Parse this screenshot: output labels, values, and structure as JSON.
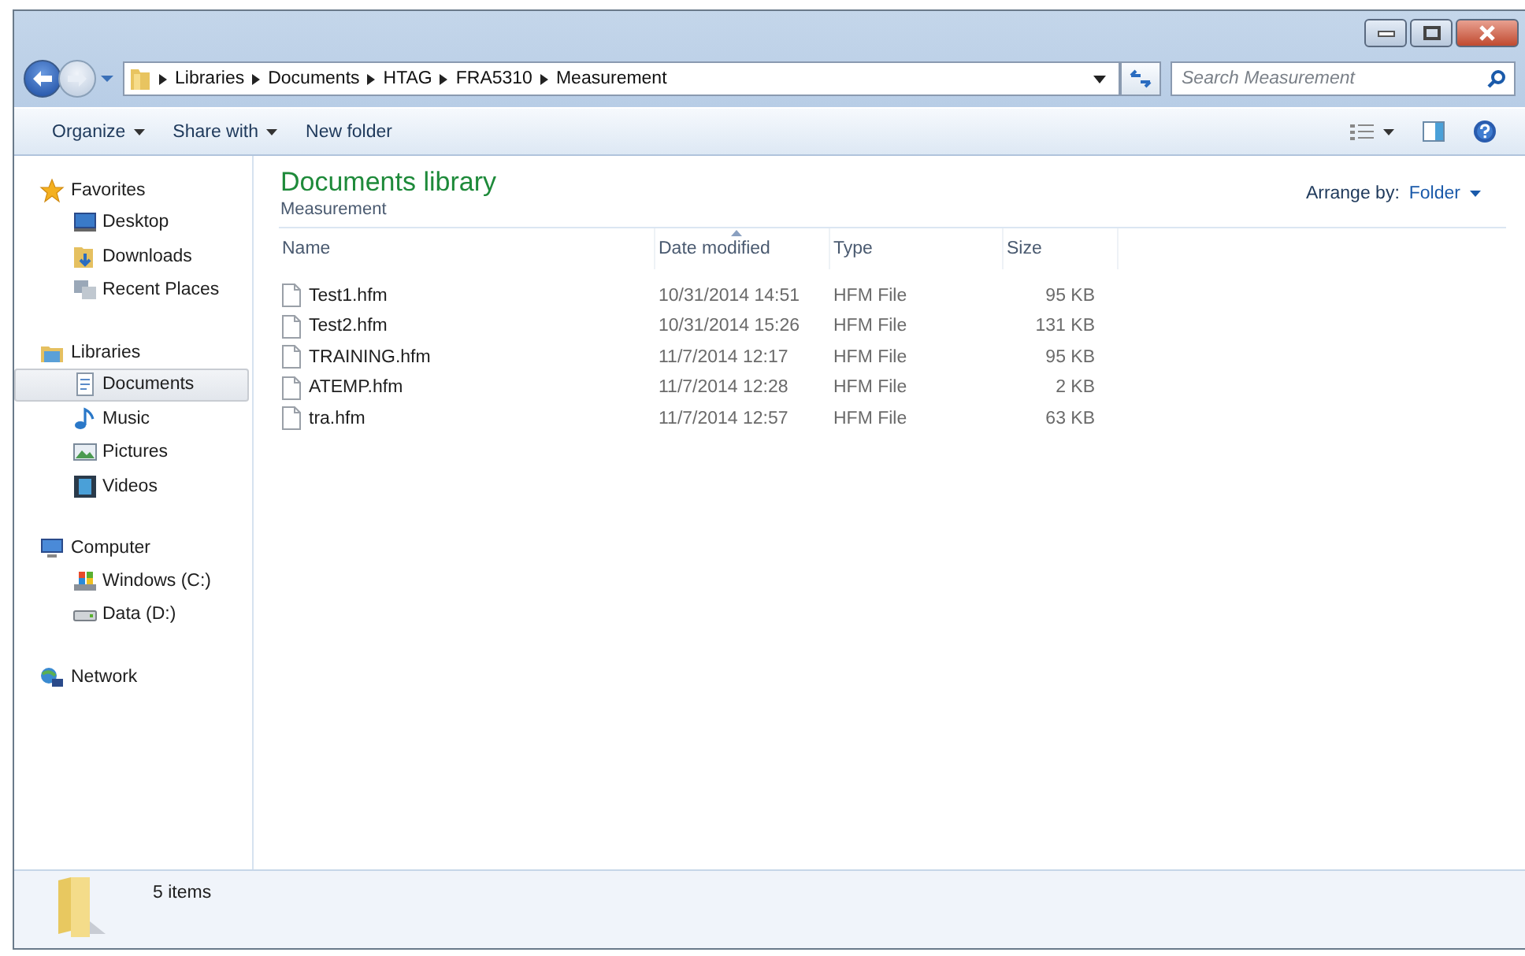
{
  "address": {
    "crumbs": [
      "Libraries",
      "Documents",
      "HTAG",
      "FRA5310",
      "Measurement"
    ]
  },
  "search": {
    "placeholder": "Search Measurement"
  },
  "toolbar": {
    "buttons": [
      {
        "label": "Organize",
        "dropdown": true
      },
      {
        "label": "Share with",
        "dropdown": true
      },
      {
        "label": "New folder",
        "dropdown": false
      }
    ]
  },
  "sidebar": {
    "groups": [
      {
        "label": "Favorites",
        "items": [
          {
            "label": "Desktop",
            "selected": false
          },
          {
            "label": "Downloads",
            "selected": false
          },
          {
            "label": "Recent Places",
            "selected": false
          }
        ]
      },
      {
        "label": "Libraries",
        "items": [
          {
            "label": "Documents",
            "selected": true
          },
          {
            "label": "Music",
            "selected": false
          },
          {
            "label": "Pictures",
            "selected": false
          },
          {
            "label": "Videos",
            "selected": false
          }
        ]
      },
      {
        "label": "Computer",
        "items": [
          {
            "label": "Windows (C:)",
            "selected": false
          },
          {
            "label": "Data (D:)",
            "selected": false
          }
        ]
      },
      {
        "label": "Network"
      }
    ]
  },
  "library": {
    "title": "Documents library",
    "subtitle": "Measurement",
    "arrange_label": "Arrange by:",
    "arrange_value": "Folder"
  },
  "table": {
    "columns": [
      {
        "label": "Name",
        "sorted": false
      },
      {
        "label": "Date modified",
        "sorted": true
      },
      {
        "label": "Type",
        "sorted": false
      },
      {
        "label": "Size",
        "sorted": false
      }
    ],
    "rows": [
      [
        "Test1.hfm",
        "10/31/2014 14:51",
        "HFM File",
        "95 KB"
      ],
      [
        "Test2.hfm",
        "10/31/2014 15:26",
        "HFM File",
        "131 KB"
      ],
      [
        "TRAINING.hfm",
        "11/7/2014 12:17",
        "HFM File",
        "95 KB"
      ],
      [
        "ATEMP.hfm",
        "11/7/2014 12:28",
        "HFM File",
        "2 KB"
      ],
      [
        "tra.hfm",
        "11/7/2014 12:57",
        "HFM File",
        "63 KB"
      ]
    ]
  },
  "status_bar": {
    "text": "5 items"
  }
}
